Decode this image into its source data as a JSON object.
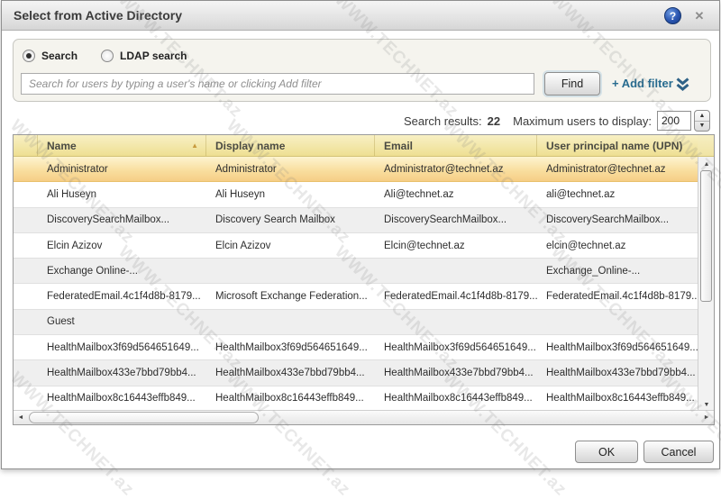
{
  "window": {
    "title": "Select from Active Directory",
    "help_icon": "?",
    "close_icon": "✕"
  },
  "search_panel": {
    "radio_search_label": "Search",
    "radio_ldap_label": "LDAP search",
    "radio_selected": "Search",
    "search_placeholder": "Search for users by typing a user's name or clicking Add filter",
    "search_value": "",
    "find_button": "Find",
    "add_filter_link": "+ Add filter"
  },
  "results_bar": {
    "results_label": "Search results:",
    "results_count": "22",
    "max_users_label": "Maximum users to display:",
    "max_users_value": "200"
  },
  "table": {
    "columns": [
      "Name",
      "Display name",
      "Email",
      "User principal name (UPN)"
    ],
    "sort_column": "Name",
    "sort_direction": "ascending",
    "rows": [
      {
        "name": "Administrator",
        "display_name": "Administrator",
        "email": "Administrator@technet.az",
        "upn": "Administrator@technet.az",
        "selected": true
      },
      {
        "name": "Ali Huseyn",
        "display_name": "Ali Huseyn",
        "email": "Ali@technet.az",
        "upn": "ali@technet.az",
        "selected": false
      },
      {
        "name": "DiscoverySearchMailbox...",
        "display_name": "Discovery Search Mailbox",
        "email": "DiscoverySearchMailbox...",
        "upn": "DiscoverySearchMailbox...",
        "selected": false
      },
      {
        "name": "Elcin Azizov",
        "display_name": "Elcin Azizov",
        "email": "Elcin@technet.az",
        "upn": "elcin@technet.az",
        "selected": false
      },
      {
        "name": "Exchange Online-...",
        "display_name": "",
        "email": "",
        "upn": "Exchange_Online-...",
        "selected": false
      },
      {
        "name": "FederatedEmail.4c1f4d8b-8179...",
        "display_name": "Microsoft Exchange Federation...",
        "email": "FederatedEmail.4c1f4d8b-8179...",
        "upn": "FederatedEmail.4c1f4d8b-8179...",
        "selected": false
      },
      {
        "name": "Guest",
        "display_name": "",
        "email": "",
        "upn": "",
        "selected": false
      },
      {
        "name": "HealthMailbox3f69d564651649...",
        "display_name": "HealthMailbox3f69d564651649...",
        "email": "HealthMailbox3f69d564651649...",
        "upn": "HealthMailbox3f69d564651649...",
        "selected": false
      },
      {
        "name": "HealthMailbox433e7bbd79bb4...",
        "display_name": "HealthMailbox433e7bbd79bb4...",
        "email": "HealthMailbox433e7bbd79bb4...",
        "upn": "HealthMailbox433e7bbd79bb4...",
        "selected": false
      },
      {
        "name": "HealthMailbox8c16443effb849...",
        "display_name": "HealthMailbox8c16443effb849...",
        "email": "HealthMailbox8c16443effb849...",
        "upn": "HealthMailbox8c16443effb849...",
        "selected": false
      }
    ]
  },
  "footer": {
    "ok_button": "OK",
    "cancel_button": "Cancel"
  },
  "watermark_text": "WWW.TECHNET.az",
  "colors": {
    "accent_link_blue": "#276b8f",
    "header_yellow": "#eedf92",
    "selected_row_orange": "#f6ce86",
    "help_icon_blue": "#2a55b0",
    "titlebar_gray": "#d6d6d6"
  }
}
